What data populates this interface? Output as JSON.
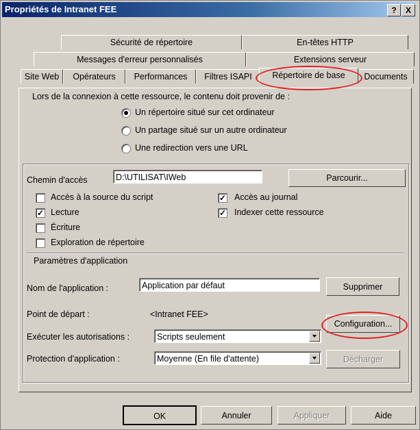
{
  "window": {
    "title": "Propriétés de Intranet FEE",
    "help_btn": "?",
    "close_btn": "X"
  },
  "tabs": {
    "row1": [
      "Sécurité de répertoire",
      "En-têtes HTTP"
    ],
    "row2": [
      "Messages d'erreur personnalisés",
      "Extensions serveur"
    ],
    "row3": [
      "Site Web",
      "Opérateurs",
      "Performances",
      "Filtres ISAPI",
      "Répertoire de base",
      "Documents"
    ]
  },
  "content_source": {
    "prompt": "Lors de la connexion à cette ressource, le contenu doit provenir de :",
    "options": [
      "Un répertoire situé sur cet ordinateur",
      "Un partage situé sur un autre ordinateur",
      "Une redirection vers une URL"
    ],
    "selected_index": 0
  },
  "path": {
    "label": "Chemin d'accès",
    "value": "D:\\UTILISAT\\IWeb",
    "browse_button": "Parcourir..."
  },
  "permissions": {
    "source_access": {
      "label": "Accès à la source du script",
      "checked": false
    },
    "read": {
      "label": "Lecture",
      "checked": true
    },
    "write": {
      "label": "Écriture",
      "checked": false
    },
    "dir_browsing": {
      "label": "Exploration de répertoire",
      "checked": false
    },
    "log_access": {
      "label": "Accès au journal",
      "checked": true
    },
    "index_resource": {
      "label": "Indexer cette ressource",
      "checked": true
    }
  },
  "app_settings": {
    "section_label": "Paramètres d'application",
    "app_name_label": "Nom de l'application :",
    "app_name_value": "Application par défaut",
    "remove_button": "Supprimer",
    "start_point_label": "Point de départ :",
    "start_point_value": "<Intranet FEE>",
    "config_button": "Configuration...",
    "exec_permissions_label": "Exécuter les autorisations :",
    "exec_permissions_value": "Scripts seulement",
    "protection_label": "Protection d'application :",
    "protection_value": "Moyenne (En file d'attente)",
    "unload_button": "Décharger"
  },
  "footer": {
    "ok": "OK",
    "cancel": "Annuler",
    "apply": "Appliquer",
    "help": "Aide"
  },
  "annotation_color": "#e02020"
}
